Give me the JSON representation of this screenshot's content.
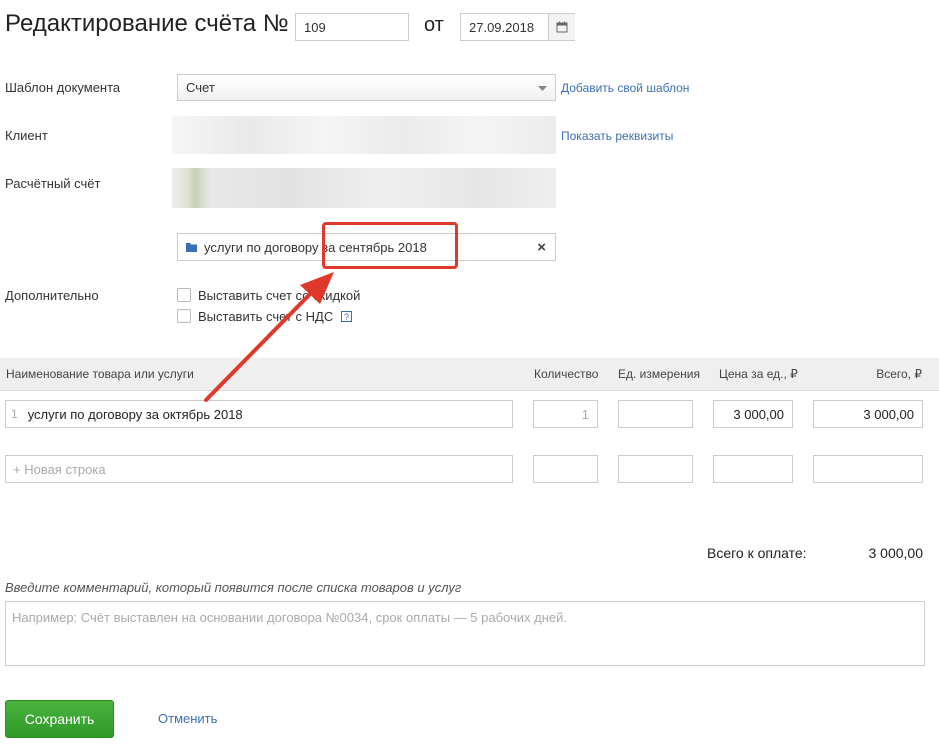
{
  "header": {
    "title": "Редактирование счёта №",
    "invoice_number": "109",
    "date_prefix": "от",
    "date": "27.09.2018"
  },
  "form": {
    "template_label": "Шаблон документа",
    "template_value": "Счет",
    "add_template_link": "Добавить свой шаблон",
    "client_label": "Клиент",
    "show_details_link": "Показать реквизиты",
    "account_label": "Расчётный счёт",
    "contract_tag": "услуги по договору за сентябрь 2018",
    "additional_label": "Дополнительно",
    "discount_checkbox": "Выставить счет со скидкой",
    "vat_checkbox": "Выставить счет с НДС",
    "vat_help": "?"
  },
  "table": {
    "headers": {
      "name": "Наименование товара или услуги",
      "qty": "Количество",
      "unit": "Ед. измерения",
      "price": "Цена за ед., ₽",
      "total": "Всего, ₽"
    },
    "rows": [
      {
        "index": "1",
        "name": "услуги по договору за октябрь 2018",
        "qty": "1",
        "unit": "",
        "price": "3 000,00",
        "total": "3 000,00"
      }
    ],
    "new_row_placeholder": "+ Новая строка"
  },
  "summary": {
    "total_label": "Всего к оплате:",
    "total_value": "3 000,00"
  },
  "comment": {
    "label": "Введите комментарий, который появится после списка товаров и услуг",
    "placeholder": "Например: Счёт выставлен на основании договора №0034, срок оплаты — 5 рабочих дней."
  },
  "actions": {
    "save": "Сохранить",
    "cancel": "Отменить"
  },
  "colors": {
    "accent_link": "#3a6fb5",
    "save_green": "#3aa62f",
    "annotation_red": "#e0392b"
  }
}
